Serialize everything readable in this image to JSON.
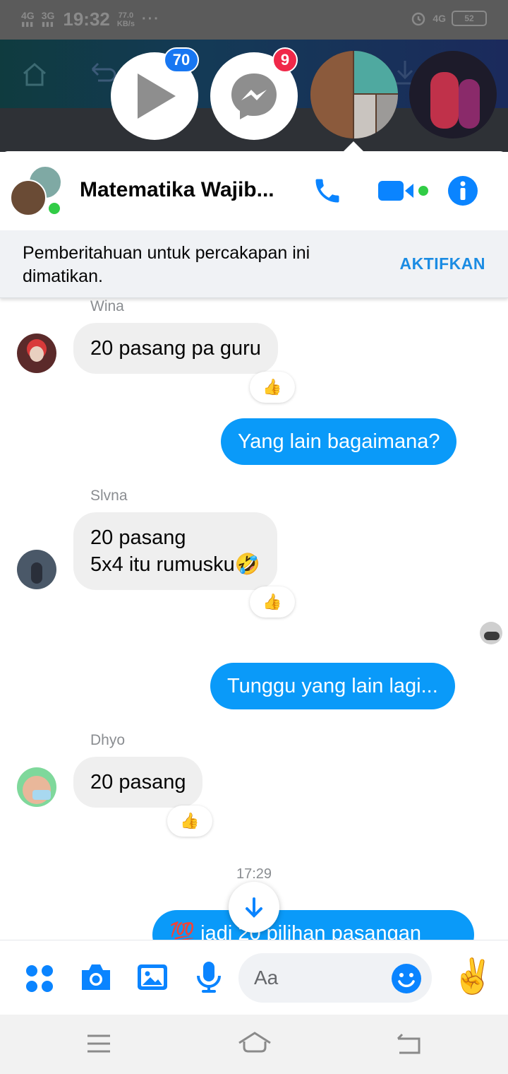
{
  "status_bar": {
    "net1": "4G",
    "net2": "3G",
    "time": "19:32",
    "speed_value": "77.0",
    "speed_unit": "KB/s",
    "more": "···",
    "net_right": "4G",
    "battery": "52"
  },
  "chat_heads": {
    "video_badge": "70",
    "messenger_badge": "9"
  },
  "header": {
    "title": "Matematika Wajib..."
  },
  "notice": {
    "text": "Pemberitahuan untuk percakapan ini dimatikan.",
    "action": "AKTIFKAN"
  },
  "messages": [
    {
      "sender": "Wina",
      "text": "20 pasang pa guru",
      "reaction": "👍"
    },
    {
      "text": "Yang lain bagaimana?"
    },
    {
      "sender": "Slvna",
      "line1": "20 pasang",
      "line2": "5x4 itu rumusku🤣",
      "reaction": "👍"
    },
    {
      "text": "Tunggu yang lain lagi..."
    },
    {
      "sender": "Dhyo",
      "text": "20 pasang",
      "reaction": "👍"
    },
    {
      "timestamp": "17:29"
    },
    {
      "text": "💯 jadi 20 pilihan pasangan"
    }
  ],
  "composer": {
    "placeholder": "Aa",
    "quick_reaction": "✌️"
  },
  "colors": {
    "accent": "#0a9af9",
    "brand_blue": "#1877f2",
    "badge_red": "#f02849",
    "online_green": "#31cc46"
  }
}
